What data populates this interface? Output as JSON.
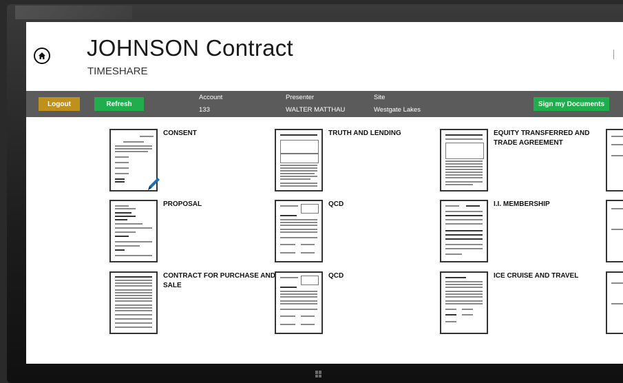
{
  "header": {
    "title": "JOHNSON Contract",
    "subtitle": "TIMESHARE"
  },
  "toolbar": {
    "logout_label": "Logout",
    "refresh_label": "Refresh",
    "sign_label": "Sign my Documents",
    "account_label": "Account",
    "account_value": "133",
    "presenter_label": "Presenter",
    "presenter_value": "WALTER MATTHAU",
    "site_label": "Site",
    "site_value": "Westgate Lakes"
  },
  "documents": [
    {
      "title": "CONSENT"
    },
    {
      "title": "TRUTH AND LENDING"
    },
    {
      "title": "EQUITY TRANSFERRED AND TRADE AGREEMENT"
    },
    {
      "title": "PROPOSAL"
    },
    {
      "title": "QCD"
    },
    {
      "title": "I.I. MEMBERSHIP"
    },
    {
      "title": "CONTRACT FOR PURCHASE AND SALE"
    },
    {
      "title": "QCD"
    },
    {
      "title": "ICE CRUISE AND TRAVEL"
    }
  ],
  "icons": {
    "home": "home-icon",
    "pen": "pen-icon",
    "windows": "windows-logo-icon"
  },
  "colors": {
    "toolbar_bg": "#5b5b5b",
    "logout": "#c0901c",
    "accent_green": "#1fae4b"
  }
}
